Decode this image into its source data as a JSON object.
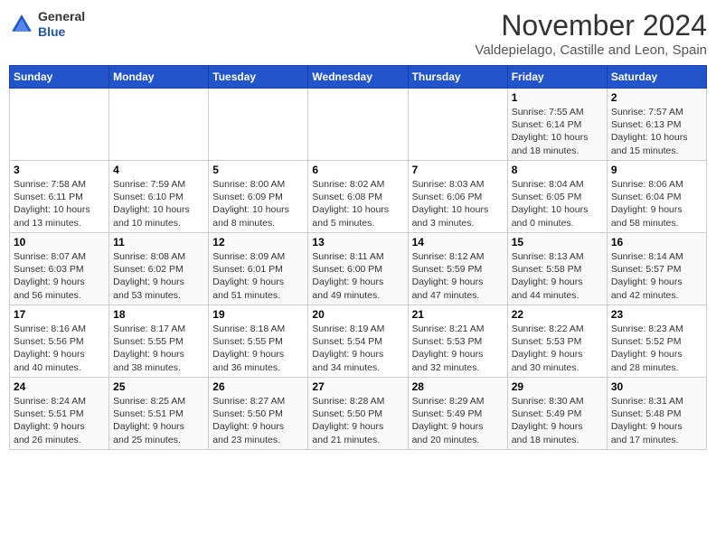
{
  "header": {
    "logo_line1": "General",
    "logo_line2": "Blue",
    "month_year": "November 2024",
    "location": "Valdepielago, Castille and Leon, Spain"
  },
  "days_of_week": [
    "Sunday",
    "Monday",
    "Tuesday",
    "Wednesday",
    "Thursday",
    "Friday",
    "Saturday"
  ],
  "weeks": [
    [
      {
        "day": "",
        "info": ""
      },
      {
        "day": "",
        "info": ""
      },
      {
        "day": "",
        "info": ""
      },
      {
        "day": "",
        "info": ""
      },
      {
        "day": "",
        "info": ""
      },
      {
        "day": "1",
        "info": "Sunrise: 7:55 AM\nSunset: 6:14 PM\nDaylight: 10 hours\nand 18 minutes."
      },
      {
        "day": "2",
        "info": "Sunrise: 7:57 AM\nSunset: 6:13 PM\nDaylight: 10 hours\nand 15 minutes."
      }
    ],
    [
      {
        "day": "3",
        "info": "Sunrise: 7:58 AM\nSunset: 6:11 PM\nDaylight: 10 hours\nand 13 minutes."
      },
      {
        "day": "4",
        "info": "Sunrise: 7:59 AM\nSunset: 6:10 PM\nDaylight: 10 hours\nand 10 minutes."
      },
      {
        "day": "5",
        "info": "Sunrise: 8:00 AM\nSunset: 6:09 PM\nDaylight: 10 hours\nand 8 minutes."
      },
      {
        "day": "6",
        "info": "Sunrise: 8:02 AM\nSunset: 6:08 PM\nDaylight: 10 hours\nand 5 minutes."
      },
      {
        "day": "7",
        "info": "Sunrise: 8:03 AM\nSunset: 6:06 PM\nDaylight: 10 hours\nand 3 minutes."
      },
      {
        "day": "8",
        "info": "Sunrise: 8:04 AM\nSunset: 6:05 PM\nDaylight: 10 hours\nand 0 minutes."
      },
      {
        "day": "9",
        "info": "Sunrise: 8:06 AM\nSunset: 6:04 PM\nDaylight: 9 hours\nand 58 minutes."
      }
    ],
    [
      {
        "day": "10",
        "info": "Sunrise: 8:07 AM\nSunset: 6:03 PM\nDaylight: 9 hours\nand 56 minutes."
      },
      {
        "day": "11",
        "info": "Sunrise: 8:08 AM\nSunset: 6:02 PM\nDaylight: 9 hours\nand 53 minutes."
      },
      {
        "day": "12",
        "info": "Sunrise: 8:09 AM\nSunset: 6:01 PM\nDaylight: 9 hours\nand 51 minutes."
      },
      {
        "day": "13",
        "info": "Sunrise: 8:11 AM\nSunset: 6:00 PM\nDaylight: 9 hours\nand 49 minutes."
      },
      {
        "day": "14",
        "info": "Sunrise: 8:12 AM\nSunset: 5:59 PM\nDaylight: 9 hours\nand 47 minutes."
      },
      {
        "day": "15",
        "info": "Sunrise: 8:13 AM\nSunset: 5:58 PM\nDaylight: 9 hours\nand 44 minutes."
      },
      {
        "day": "16",
        "info": "Sunrise: 8:14 AM\nSunset: 5:57 PM\nDaylight: 9 hours\nand 42 minutes."
      }
    ],
    [
      {
        "day": "17",
        "info": "Sunrise: 8:16 AM\nSunset: 5:56 PM\nDaylight: 9 hours\nand 40 minutes."
      },
      {
        "day": "18",
        "info": "Sunrise: 8:17 AM\nSunset: 5:55 PM\nDaylight: 9 hours\nand 38 minutes."
      },
      {
        "day": "19",
        "info": "Sunrise: 8:18 AM\nSunset: 5:55 PM\nDaylight: 9 hours\nand 36 minutes."
      },
      {
        "day": "20",
        "info": "Sunrise: 8:19 AM\nSunset: 5:54 PM\nDaylight: 9 hours\nand 34 minutes."
      },
      {
        "day": "21",
        "info": "Sunrise: 8:21 AM\nSunset: 5:53 PM\nDaylight: 9 hours\nand 32 minutes."
      },
      {
        "day": "22",
        "info": "Sunrise: 8:22 AM\nSunset: 5:53 PM\nDaylight: 9 hours\nand 30 minutes."
      },
      {
        "day": "23",
        "info": "Sunrise: 8:23 AM\nSunset: 5:52 PM\nDaylight: 9 hours\nand 28 minutes."
      }
    ],
    [
      {
        "day": "24",
        "info": "Sunrise: 8:24 AM\nSunset: 5:51 PM\nDaylight: 9 hours\nand 26 minutes."
      },
      {
        "day": "25",
        "info": "Sunrise: 8:25 AM\nSunset: 5:51 PM\nDaylight: 9 hours\nand 25 minutes."
      },
      {
        "day": "26",
        "info": "Sunrise: 8:27 AM\nSunset: 5:50 PM\nDaylight: 9 hours\nand 23 minutes."
      },
      {
        "day": "27",
        "info": "Sunrise: 8:28 AM\nSunset: 5:50 PM\nDaylight: 9 hours\nand 21 minutes."
      },
      {
        "day": "28",
        "info": "Sunrise: 8:29 AM\nSunset: 5:49 PM\nDaylight: 9 hours\nand 20 minutes."
      },
      {
        "day": "29",
        "info": "Sunrise: 8:30 AM\nSunset: 5:49 PM\nDaylight: 9 hours\nand 18 minutes."
      },
      {
        "day": "30",
        "info": "Sunrise: 8:31 AM\nSunset: 5:48 PM\nDaylight: 9 hours\nand 17 minutes."
      }
    ]
  ]
}
